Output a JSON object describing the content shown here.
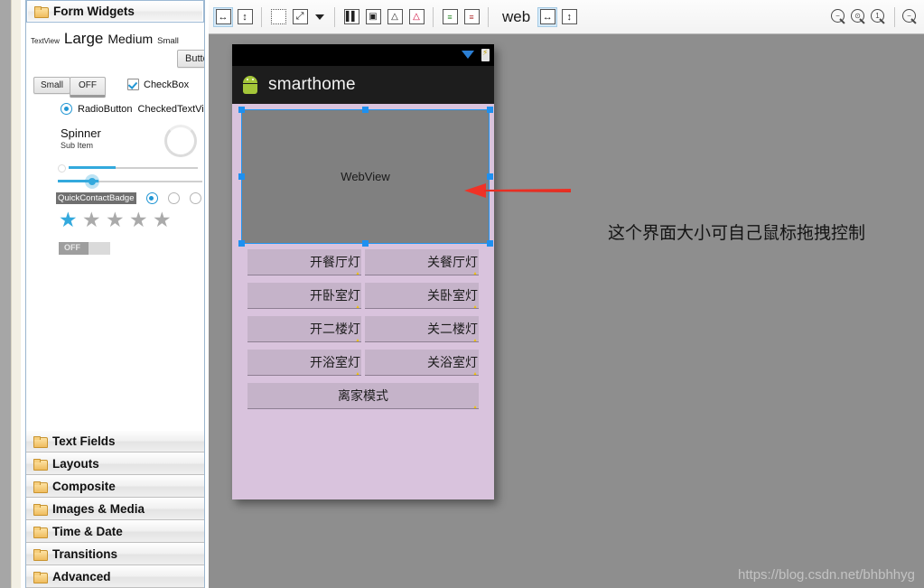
{
  "palette": {
    "selected_category": "Form Widgets",
    "categories": [
      {
        "label": "Form Widgets",
        "icon": "folder-icon",
        "selected": true
      },
      {
        "label": "Text Fields",
        "icon": "folder-icon",
        "selected": false
      },
      {
        "label": "Layouts",
        "icon": "folder-icon",
        "selected": false
      },
      {
        "label": "Composite",
        "icon": "folder-icon",
        "selected": false
      },
      {
        "label": "Images & Media",
        "icon": "folder-icon",
        "selected": false
      },
      {
        "label": "Time & Date",
        "icon": "folder-icon",
        "selected": false
      },
      {
        "label": "Transitions",
        "icon": "folder-icon",
        "selected": false
      },
      {
        "label": "Advanced",
        "icon": "folder-icon",
        "selected": false
      }
    ],
    "widgets": {
      "textview_tiny": "TextView",
      "textview_large": "Large",
      "textview_medium": "Medium",
      "textview_small": "Small",
      "button": "Button",
      "small_button": "Small",
      "toggle_button": "OFF",
      "checkbox": "CheckBox",
      "radio_button": "RadioButton",
      "checked_text_view": "CheckedTextView",
      "spinner": "Spinner",
      "spinner_sub": "Sub Item",
      "quick_contact_badge": "QuickContactBadge",
      "switch_off": "OFF",
      "rating_filled": 1,
      "rating_total": 5
    }
  },
  "toolbar": {
    "items": [
      {
        "name": "fit-width-button",
        "glyph": "↔",
        "active": true
      },
      {
        "name": "fit-height-button",
        "glyph": "↕",
        "active": false
      },
      {
        "name": "marquee-select-button",
        "glyph": "⬚",
        "active": false
      },
      {
        "name": "expand-all-button",
        "glyph": "⤢",
        "active": false
      },
      {
        "name": "dropdown-caret",
        "glyph": "▾",
        "active": false
      },
      {
        "name": "distribute-horizontal-button",
        "glyph": "▐▌",
        "active": false
      },
      {
        "name": "center-horizontal-button",
        "glyph": "▣",
        "active": false
      },
      {
        "name": "baseline-align-button",
        "glyph": "⌂",
        "active": false
      },
      {
        "name": "baseline-align-off-button",
        "glyph": "⌧",
        "active": false
      },
      {
        "name": "show-rows-button",
        "glyph": "≡",
        "active": false
      },
      {
        "name": "show-columns-button",
        "glyph": "≡",
        "active": false
      }
    ],
    "config_label": "web",
    "config_fit_width": "↔",
    "config_fit_height": "↕",
    "zoom_controls": [
      {
        "name": "zoom-out-button",
        "glyph": "−"
      },
      {
        "name": "zoom-fit-button",
        "glyph": "⊙"
      },
      {
        "name": "zoom-100-button",
        "glyph": "1"
      },
      {
        "name": "zoom-in-button",
        "glyph": "−"
      }
    ]
  },
  "device": {
    "app_title": "smarthome",
    "app_icon": "android-robot-icon",
    "status_icons": [
      "wifi-triangle-icon",
      "battery-charging-icon"
    ],
    "webview_label": "WebView",
    "selection": {
      "selected_widget": "WebView",
      "handles": 8
    },
    "buttons": [
      [
        {
          "label": "开餐厅灯",
          "warning": true
        },
        {
          "label": "关餐厅灯",
          "warning": true
        }
      ],
      [
        {
          "label": "开卧室灯",
          "warning": true
        },
        {
          "label": "关卧室灯",
          "warning": true
        }
      ],
      [
        {
          "label": "开二楼灯",
          "warning": true
        },
        {
          "label": "关二楼灯",
          "warning": true
        }
      ],
      [
        {
          "label": "开浴室灯",
          "warning": true
        },
        {
          "label": "关浴室灯",
          "warning": true
        }
      ]
    ],
    "full_button": {
      "label": "离家模式",
      "warning": true
    }
  },
  "annotation": {
    "text": "这个界面大小可自己鼠标拖拽控制",
    "arrow_color": "#f03226"
  },
  "watermark": "https://blog.csdn.net/bhbhhyg",
  "colors": {
    "canvas_bg": "#8e8e8e",
    "device_bg": "#d9c3dd",
    "widget_btn": "#c5b3c9",
    "webview_bg": "#808080",
    "selection": "#2196f3",
    "accent_blue": "#33a9dd",
    "folder": "#efbc5e"
  }
}
